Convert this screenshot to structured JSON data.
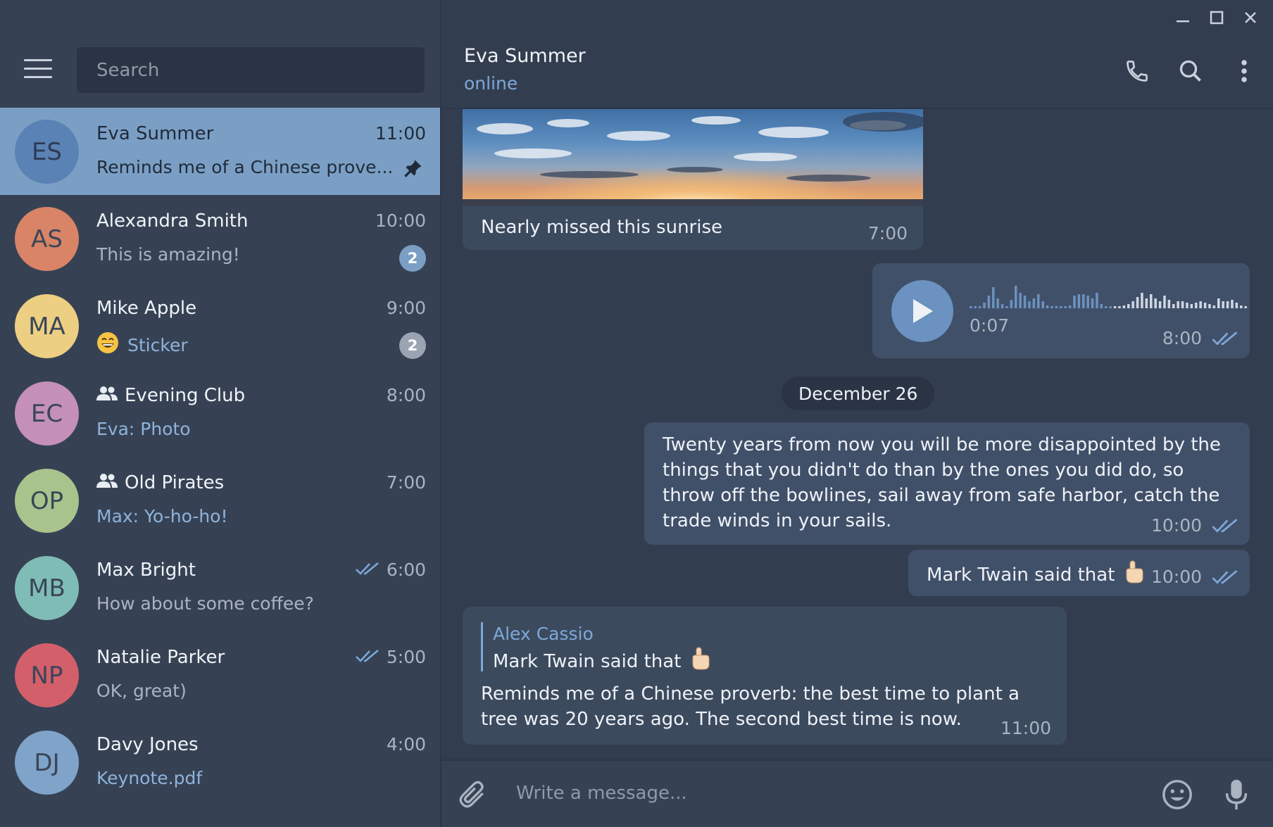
{
  "window": {
    "minimize": "minimize",
    "maximize": "maximize",
    "close": "close"
  },
  "search": {
    "placeholder": "Search"
  },
  "chats": [
    {
      "initials": "ES",
      "name": "Eva Summer",
      "time": "11:00",
      "preview": "Reminds me of a Chinese prove...",
      "color": "#5a82b4",
      "pinned": true,
      "active": true
    },
    {
      "initials": "AS",
      "name": "Alexandra Smith",
      "time": "10:00",
      "preview": "This is amazing!",
      "color": "#d98467",
      "badge": "2"
    },
    {
      "initials": "MA",
      "name": "Mike Apple",
      "time": "9:00",
      "preview": "Sticker",
      "color": "#edcf83",
      "badge": "2",
      "preview_accent": true
    },
    {
      "initials": "EC",
      "name": "Evening Club",
      "time": "8:00",
      "preview": "Eva: Photo",
      "color": "#c48fb8",
      "group": true,
      "preview_accent": true
    },
    {
      "initials": "OP",
      "name": "Old Pirates",
      "time": "7:00",
      "preview": "Max: Yo-ho-ho!",
      "color": "#a8c48c",
      "group": true,
      "preview_accent": true
    },
    {
      "initials": "MB",
      "name": "Max Bright",
      "time": "6:00",
      "preview": "How about some coffee?",
      "color": "#7fbcb6",
      "read": true
    },
    {
      "initials": "NP",
      "name": "Natalie Parker",
      "time": "5:00",
      "preview": "OK, great)",
      "color": "#d35f6a",
      "read": true
    },
    {
      "initials": "DJ",
      "name": "Davy Jones",
      "time": "4:00",
      "preview": "Keynote.pdf",
      "color": "#7fa3c9",
      "preview_accent": true
    }
  ],
  "header": {
    "name": "Eva Summer",
    "status": "online"
  },
  "messages": {
    "photo_caption": "Nearly missed this sunrise",
    "photo_time": "7:00",
    "voice_duration": "0:07",
    "voice_time": "8:00",
    "date_chip": "December 26",
    "quote_text": "Twenty years from now you will be more disappointed by the things that you didn't do than by the ones you did do, so throw off the bowlines, sail away from safe harbor, catch the trade winds in your sails.",
    "quote_time": "10:00",
    "short_text": "Mark Twain said that",
    "short_time": "10:00",
    "reply_author": "Alex Cassio",
    "reply_quoted": "Mark Twain said that",
    "reply_text": "Reminds me of a Chinese proverb: the best time to plant a tree was 20 years ago. The second best time is now.",
    "reply_time": "11:00"
  },
  "composer": {
    "placeholder": "Write a message..."
  },
  "colors": {
    "accent": "#7b9fc4",
    "check": "#7ea8d8",
    "panel": "#364254",
    "bg": "#323d4f"
  }
}
